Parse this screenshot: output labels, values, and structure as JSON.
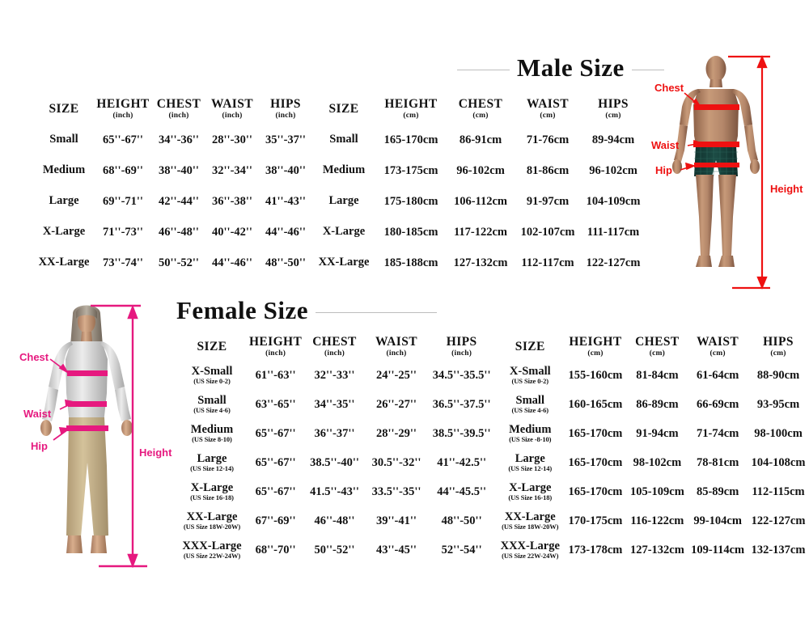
{
  "male": {
    "title": "Male Size",
    "headers_inch": [
      {
        "name": "SIZE",
        "unit": ""
      },
      {
        "name": "HEIGHT",
        "unit": "(inch)"
      },
      {
        "name": "CHEST",
        "unit": "(inch)"
      },
      {
        "name": "WAIST",
        "unit": "(inch)"
      },
      {
        "name": "HIPS",
        "unit": "(inch)"
      }
    ],
    "headers_cm": [
      {
        "name": "SIZE",
        "unit": ""
      },
      {
        "name": "HEIGHT",
        "unit": "(cm)"
      },
      {
        "name": "CHEST",
        "unit": "(cm)"
      },
      {
        "name": "WAIST",
        "unit": "(cm)"
      },
      {
        "name": "HIPS",
        "unit": "(cm)"
      }
    ],
    "rows": [
      {
        "size": "Small",
        "height_in": "65''-67''",
        "chest_in": "34''-36''",
        "waist_in": "28''-30''",
        "hips_in": "35''-37''",
        "size_cm": "Small",
        "height_cm": "165-170cm",
        "chest_cm": "86-91cm",
        "waist_cm": "71-76cm",
        "hips_cm": "89-94cm"
      },
      {
        "size": "Medium",
        "height_in": "68''-69''",
        "chest_in": "38''-40''",
        "waist_in": "32''-34''",
        "hips_in": "38''-40''",
        "size_cm": "Medium",
        "height_cm": "173-175cm",
        "chest_cm": "96-102cm",
        "waist_cm": "81-86cm",
        "hips_cm": "96-102cm"
      },
      {
        "size": "Large",
        "height_in": "69''-71''",
        "chest_in": "42''-44''",
        "waist_in": "36''-38''",
        "hips_in": "41''-43''",
        "size_cm": "Large",
        "height_cm": "175-180cm",
        "chest_cm": "106-112cm",
        "waist_cm": "91-97cm",
        "hips_cm": "104-109cm"
      },
      {
        "size": "X-Large",
        "height_in": "71''-73''",
        "chest_in": "46''-48''",
        "waist_in": "40''-42''",
        "hips_in": "44''-46''",
        "size_cm": "X-Large",
        "height_cm": "180-185cm",
        "chest_cm": "117-122cm",
        "waist_cm": "102-107cm",
        "hips_cm": "111-117cm"
      },
      {
        "size": "XX-Large",
        "height_in": "73''-74''",
        "chest_in": "50''-52''",
        "waist_in": "44''-46''",
        "hips_in": "48''-50''",
        "size_cm": "XX-Large",
        "height_cm": "185-188cm",
        "chest_cm": "127-132cm",
        "waist_cm": "112-117cm",
        "hips_cm": "122-127cm"
      }
    ],
    "figure": {
      "labels": [
        "Chest",
        "Waist",
        "Hip",
        "Height"
      ],
      "accent_color": "#ee1111"
    }
  },
  "female": {
    "title": "Female Size",
    "headers_inch": [
      {
        "name": "SIZE",
        "unit": ""
      },
      {
        "name": "HEIGHT",
        "unit": "(inch)"
      },
      {
        "name": "CHEST",
        "unit": "(inch)"
      },
      {
        "name": "WAIST",
        "unit": "(inch)"
      },
      {
        "name": "HIPS",
        "unit": "(inch)"
      }
    ],
    "headers_cm": [
      {
        "name": "SIZE",
        "unit": ""
      },
      {
        "name": "HEIGHT",
        "unit": "(cm)"
      },
      {
        "name": "CHEST",
        "unit": "(cm)"
      },
      {
        "name": "WAIST",
        "unit": "(cm)"
      },
      {
        "name": "HIPS",
        "unit": "(cm)"
      }
    ],
    "rows": [
      {
        "size": "X-Small",
        "us": "(US Size 0-2)",
        "height_in": "61''-63''",
        "chest_in": "32''-33''",
        "waist_in": "24''-25''",
        "hips_in": "34.5''-35.5''",
        "size_cm": "X-Small",
        "us_cm": "(US Size 0-2)",
        "height_cm": "155-160cm",
        "chest_cm": "81-84cm",
        "waist_cm": "61-64cm",
        "hips_cm": "88-90cm"
      },
      {
        "size": "Small",
        "us": "(US Size 4-6)",
        "height_in": "63''-65''",
        "chest_in": "34''-35''",
        "waist_in": "26''-27''",
        "hips_in": "36.5''-37.5''",
        "size_cm": "Small",
        "us_cm": "(US Size 4-6)",
        "height_cm": "160-165cm",
        "chest_cm": "86-89cm",
        "waist_cm": "66-69cm",
        "hips_cm": "93-95cm"
      },
      {
        "size": "Medium",
        "us": "(US Size 8-10)",
        "height_in": "65''-67''",
        "chest_in": "36''-37''",
        "waist_in": "28''-29''",
        "hips_in": "38.5''-39.5''",
        "size_cm": "Medium",
        "us_cm": "(US Size -8-10)",
        "height_cm": "165-170cm",
        "chest_cm": "91-94cm",
        "waist_cm": "71-74cm",
        "hips_cm": "98-100cm"
      },
      {
        "size": "Large",
        "us": "(US Size 12-14)",
        "height_in": "65''-67''",
        "chest_in": "38.5''-40''",
        "waist_in": "30.5''-32''",
        "hips_in": "41''-42.5''",
        "size_cm": "Large",
        "us_cm": "(US Size 12-14)",
        "height_cm": "165-170cm",
        "chest_cm": "98-102cm",
        "waist_cm": "78-81cm",
        "hips_cm": "104-108cm"
      },
      {
        "size": "X-Large",
        "us": "(US Size 16-18)",
        "height_in": "65''-67''",
        "chest_in": "41.5''-43''",
        "waist_in": "33.5''-35''",
        "hips_in": "44''-45.5''",
        "size_cm": "X-Large",
        "us_cm": "(US Size 16-18)",
        "height_cm": "165-170cm",
        "chest_cm": "105-109cm",
        "waist_cm": "85-89cm",
        "hips_cm": "112-115cm"
      },
      {
        "size": "XX-Large",
        "us": "(US Size 18W-20W)",
        "height_in": "67''-69''",
        "chest_in": "46''-48''",
        "waist_in": "39''-41''",
        "hips_in": "48''-50''",
        "size_cm": "XX-Large",
        "us_cm": "(US Size 18W-20W)",
        "height_cm": "170-175cm",
        "chest_cm": "116-122cm",
        "waist_cm": "99-104cm",
        "hips_cm": "122-127cm"
      },
      {
        "size": "XXX-Large",
        "us": "(US Size 22W-24W)",
        "height_in": "68''-70''",
        "chest_in": "50''-52''",
        "waist_in": "43''-45''",
        "hips_in": "52''-54''",
        "size_cm": "XXX-Large",
        "us_cm": "(US Size 22W-24W)",
        "height_cm": "173-178cm",
        "chest_cm": "127-132cm",
        "waist_cm": "109-114cm",
        "hips_cm": "132-137cm"
      }
    ],
    "figure": {
      "labels": [
        "Chest",
        "Waist",
        "Hip",
        "Height"
      ],
      "accent_color": "#e6197f"
    }
  }
}
